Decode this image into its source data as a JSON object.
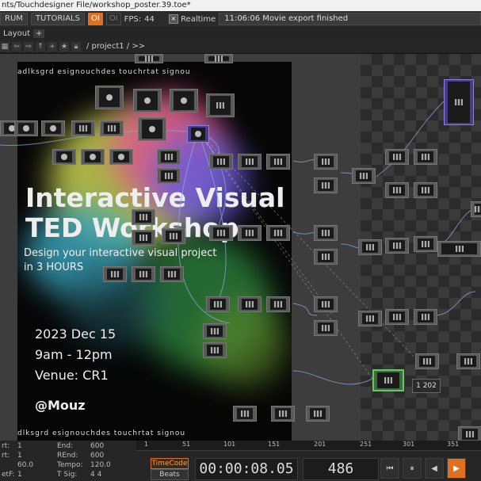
{
  "window": {
    "title": "nts/Touchdesigner File/workshop_poster.39.toe*"
  },
  "menubar": {
    "forum": "RUM",
    "tutorials": "TUTORIALS",
    "oi": "OI",
    "oi2": "OI",
    "fps_label": "FPS:",
    "fps_value": "44",
    "realtime": "Realtime",
    "status": "11:06:06 Movie export finished"
  },
  "layoutbar": {
    "label": "Layout",
    "add": "+"
  },
  "pathbar": {
    "path": "/ project1 / >>"
  },
  "poster": {
    "strip_top": "adlksgrd  esignouchdes  touchrtat  signou",
    "title_line1": "Interactive Visual",
    "title_line2": "TED Workshop",
    "subtitle_line1": "Design your interactive visual project",
    "subtitle_line2": "in 3 HOURS",
    "date": "2023 Dec 15",
    "time": "9am - 12pm",
    "venue": "Venue: CR1",
    "handle": "@Mouz",
    "strip_bottom": "dlksgrd  esignouchdes  touchrtat  signou"
  },
  "network": {
    "node_label_1": "1 202"
  },
  "bottom": {
    "left_rows": [
      {
        "label": "rt:",
        "value": "1",
        "label2": "End:",
        "value2": "600"
      },
      {
        "label": "rt:",
        "value": "1",
        "label2": "REnd:",
        "value2": "600"
      },
      {
        "label": "",
        "value": "60.0",
        "label2": "Tempo:",
        "value2": "120.0"
      },
      {
        "label": "etF:",
        "value": "1",
        "label2": "T Sig:",
        "value2": "4   4"
      }
    ],
    "ruler_ticks": [
      "1",
      "51",
      "101",
      "151",
      "201",
      "251",
      "301",
      "351"
    ],
    "timecode_label": "TimeCode",
    "beats_label": "Beats",
    "timecode": "00:00:08.05",
    "frame": "486",
    "btn_rewind": "⏮",
    "btn_pause": "⏸",
    "btn_back": "◀",
    "btn_play": "▶"
  }
}
